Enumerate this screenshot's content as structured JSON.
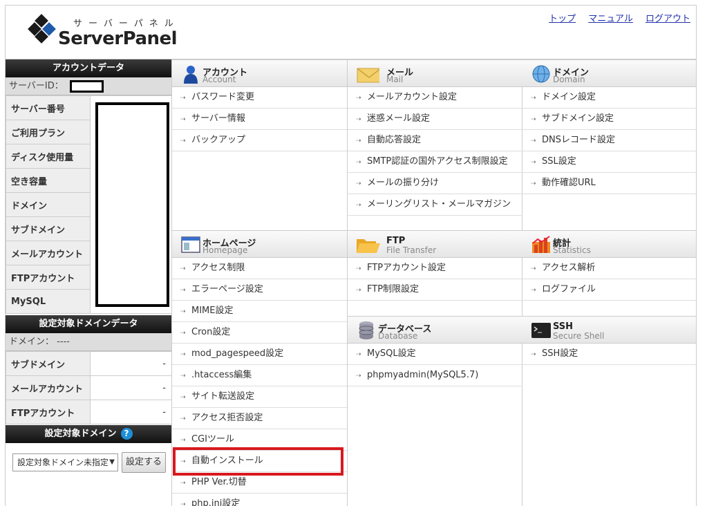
{
  "header": {
    "logo_sub": "サーバーパネル",
    "logo_main": "ServerPanel",
    "links": [
      "トップ",
      "マニュアル",
      "ログアウト"
    ]
  },
  "account_data": {
    "title": "アカウントデータ",
    "server_id_label": "サーバーID：",
    "rows": [
      "サーバー番号",
      "ご利用プラン",
      "ディスク使用量",
      "空き容量",
      "ドメイン",
      "サブドメイン",
      "メールアカウント",
      "FTPアカウント",
      "MySQL"
    ]
  },
  "domain_data": {
    "title": "設定対象ドメインデータ",
    "domain_label": "ドメイン： ----",
    "rows": [
      {
        "k": "サブドメイン",
        "v": "-"
      },
      {
        "k": "メールアカウント",
        "v": "-"
      },
      {
        "k": "FTPアカウント",
        "v": "-"
      }
    ]
  },
  "domain_select": {
    "title": "設定対象ドメイン",
    "help": "?",
    "selected": "設定対象ドメイン未指定",
    "arrow": "▼",
    "button": "設定する"
  },
  "categories": {
    "account": {
      "title": "アカウント",
      "sub": "Account",
      "items": [
        "パスワード変更",
        "サーバー情報",
        "バックアップ"
      ]
    },
    "mail": {
      "title": "メール",
      "sub": "Mail",
      "items": [
        "メールアカウント設定",
        "迷惑メール設定",
        "自動応答設定",
        "SMTP認証の国外アクセス制限設定",
        "メールの振り分け",
        "メーリングリスト・メールマガジン"
      ]
    },
    "domain": {
      "title": "ドメイン",
      "sub": "Domain",
      "items": [
        "ドメイン設定",
        "サブドメイン設定",
        "DNSレコード設定",
        "SSL設定",
        "動作確認URL"
      ]
    },
    "homepage": {
      "title": "ホームページ",
      "sub": "Homepage",
      "items": [
        "アクセス制限",
        "エラーページ設定",
        "MIME設定",
        "Cron設定",
        "mod_pagespeed設定",
        ".htaccess編集",
        "サイト転送設定",
        "アクセス拒否設定",
        "CGIツール",
        "自動インストール",
        "PHP Ver.切替",
        "php.ini設定"
      ]
    },
    "ftp": {
      "title": "FTP",
      "sub": "File Transfer",
      "items": [
        "FTPアカウント設定",
        "FTP制限設定"
      ]
    },
    "stats": {
      "title": "統計",
      "sub": "Statistics",
      "items": [
        "アクセス解析",
        "ログファイル"
      ]
    },
    "database": {
      "title": "データベース",
      "sub": "Database",
      "items": [
        "MySQL設定",
        "phpmyadmin(MySQL5.7)"
      ]
    },
    "ssh": {
      "title": "SSH",
      "sub": "Secure Shell",
      "items": [
        "SSH設定"
      ]
    }
  },
  "colors": {
    "highlight": "#d7191f",
    "logo_dark": "#1a1a1a",
    "logo_blue": "#1e5aa8",
    "link": "#2233aa"
  }
}
